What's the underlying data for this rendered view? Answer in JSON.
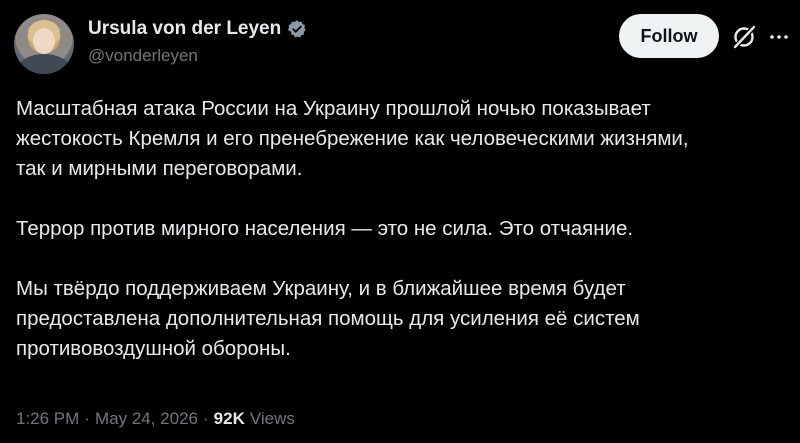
{
  "author": {
    "display_name": "Ursula von der Leyen",
    "handle": "@vonderleyen",
    "verified_icon": "verified-badge-icon",
    "verified_color": "#1d9bf0"
  },
  "actions": {
    "follow_label": "Follow",
    "grok_icon": "grok-icon",
    "more_icon": "more-icon"
  },
  "post": {
    "paragraphs": [
      "Масштабная атака России на Украину прошлой ночью показывает\nжестокость Кремля и его пренебрежение как человеческими жизнями,\nтак и мирными переговорами.",
      "Террор против мирного населения — это не сила. Это отчаяние.",
      "Мы твёрдо поддерживаем Украину, и в ближайшее время будет\nпредоставлена дополнительная помощь для усиления её систем\nпротивовоздушной обороны."
    ]
  },
  "meta": {
    "time": "1:26 PM",
    "separator": "·",
    "date": "May 24, 2026",
    "views_count": "92K",
    "views_label": "Views"
  },
  "colors": {
    "background": "#000000",
    "primary_text": "#e7e9ea",
    "secondary_text": "#71767b",
    "follow_bg": "#eff3f4",
    "follow_text": "#0f1419"
  }
}
